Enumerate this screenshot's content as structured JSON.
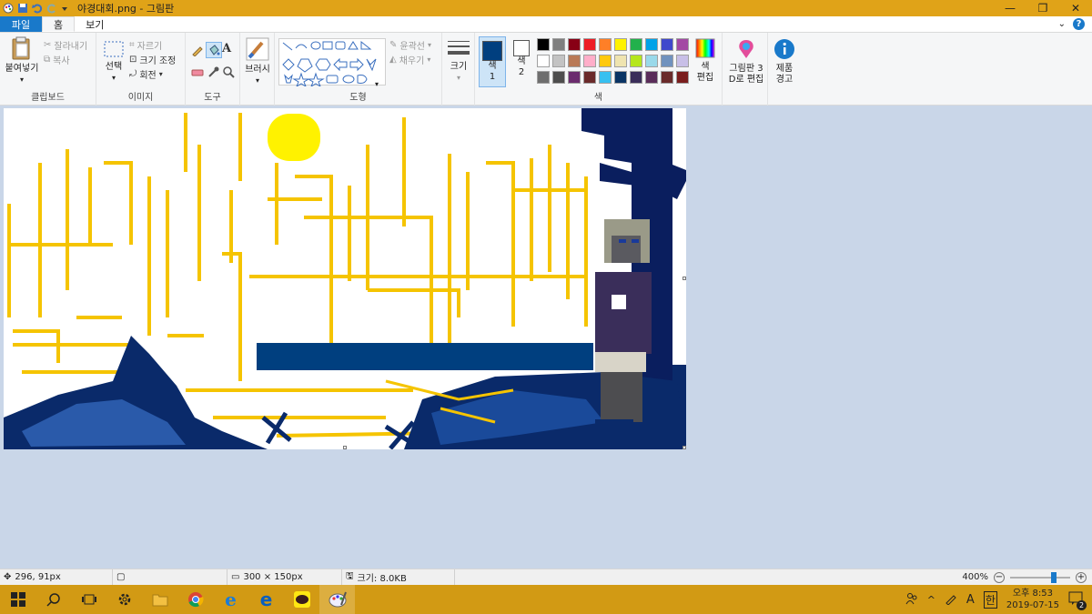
{
  "window": {
    "title": "야경대회.png - 그림판",
    "controls": [
      "minimize",
      "maximize",
      "close"
    ]
  },
  "tabs": {
    "file": "파일",
    "home": "홈",
    "view": "보기"
  },
  "ribbon": {
    "clipboard": {
      "label": "클립보드",
      "paste": "붙여넣기",
      "cut": "잘라내기",
      "copy": "복사"
    },
    "image": {
      "label": "이미지",
      "select": "선택",
      "crop": "자르기",
      "resize": "크기 조정",
      "rotate": "회전"
    },
    "tools": {
      "label": "도구"
    },
    "brushes": {
      "label": "브러시"
    },
    "shapes": {
      "label": "도형",
      "outline": "윤곽선",
      "fill": "채우기"
    },
    "size": {
      "label": "크기"
    },
    "colors": {
      "label": "색",
      "color1": "색\n1",
      "color1_a": "색",
      "color1_b": "1",
      "color2_a": "색",
      "color2_b": "2",
      "edit_a": "색",
      "edit_b": "편집",
      "color1_value": "#003f7f",
      "color2_value": "#ffffff",
      "palette": [
        "#000000",
        "#7f7f7f",
        "#880015",
        "#ed1c24",
        "#ff7f27",
        "#fff200",
        "#22b14c",
        "#00a2e8",
        "#3f48cc",
        "#a349a4",
        "#ffffff",
        "#c3c3c3",
        "#b97a57",
        "#ffaec9",
        "#ffc90e",
        "#efe4b0",
        "#b5e61d",
        "#99d9ea",
        "#7092be",
        "#c8bfe7",
        "#6e6e6e",
        "#4d4d4d",
        "#6b2c6e",
        "#6a2a2a",
        "#37c0f0",
        "#0a3464",
        "#3a2e5a",
        "#5a2d5a",
        "#6a2b2b",
        "#7a1d1d"
      ]
    },
    "paint3d": {
      "line1": "그림판 3",
      "line2": "D로 편집"
    },
    "product": {
      "line1": "제품",
      "line2": "경고"
    }
  },
  "status": {
    "cursor": "296, 91px",
    "dimensions": "300 × 150px",
    "filesize": "크기: 8.0KB",
    "zoom": "400%",
    "zoom_fraction": 0.75
  },
  "taskbar": {
    "ime": "A",
    "lang": "한",
    "clock_time": "오후 8:53",
    "clock_date": "2019-07-15",
    "notif_count": "2"
  },
  "colors": {
    "accent": "#e0a318",
    "file_tab": "#1979ca",
    "taskbar": "#d29a14",
    "canvas_yellow": "#f5c400",
    "canvas_navy": "#0a2a6a"
  }
}
